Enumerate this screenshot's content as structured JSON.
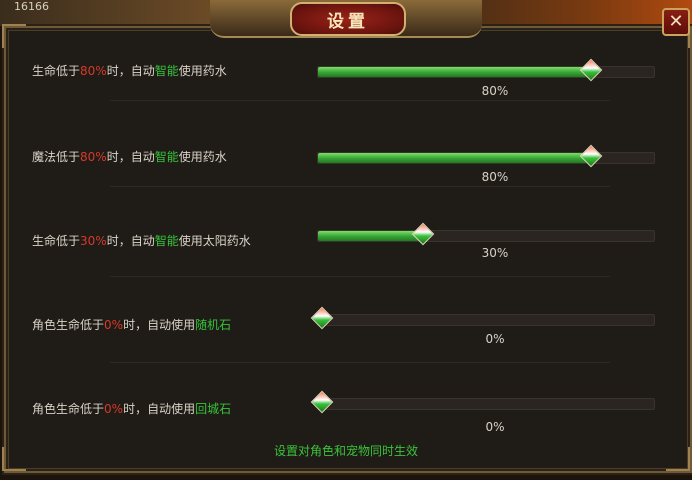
{
  "top_left_text": "16166",
  "title": "设置",
  "close_symbol": "✕",
  "settings": [
    {
      "parts": [
        "生命低于",
        "80%",
        "时，自动",
        "智能",
        "使用药水"
      ],
      "value_label": "80%",
      "level": 0.8
    },
    {
      "parts": [
        "魔法低于",
        "80%",
        "时，自动",
        "智能",
        "使用药水"
      ],
      "value_label": "80%",
      "level": 0.8
    },
    {
      "parts": [
        "生命低于",
        "30%",
        "时，自动",
        "智能",
        "使用太阳药水"
      ],
      "value_label": "30%",
      "level": 0.3
    },
    {
      "parts": [
        "角色生命低于",
        "0%",
        "时，自动使用",
        "随机石"
      ],
      "value_label": "0%",
      "level": 0.0
    },
    {
      "parts": [
        "角色生命低于",
        "0%",
        "时，自动使用",
        "回城石"
      ],
      "value_label": "0%",
      "level": 0.0
    }
  ],
  "footer_note": "设置对角色和宠物同时生效",
  "colors": {
    "highlight_red": "#d63a2a",
    "highlight_green": "#35c43a",
    "fill_green": "#3aa838"
  }
}
